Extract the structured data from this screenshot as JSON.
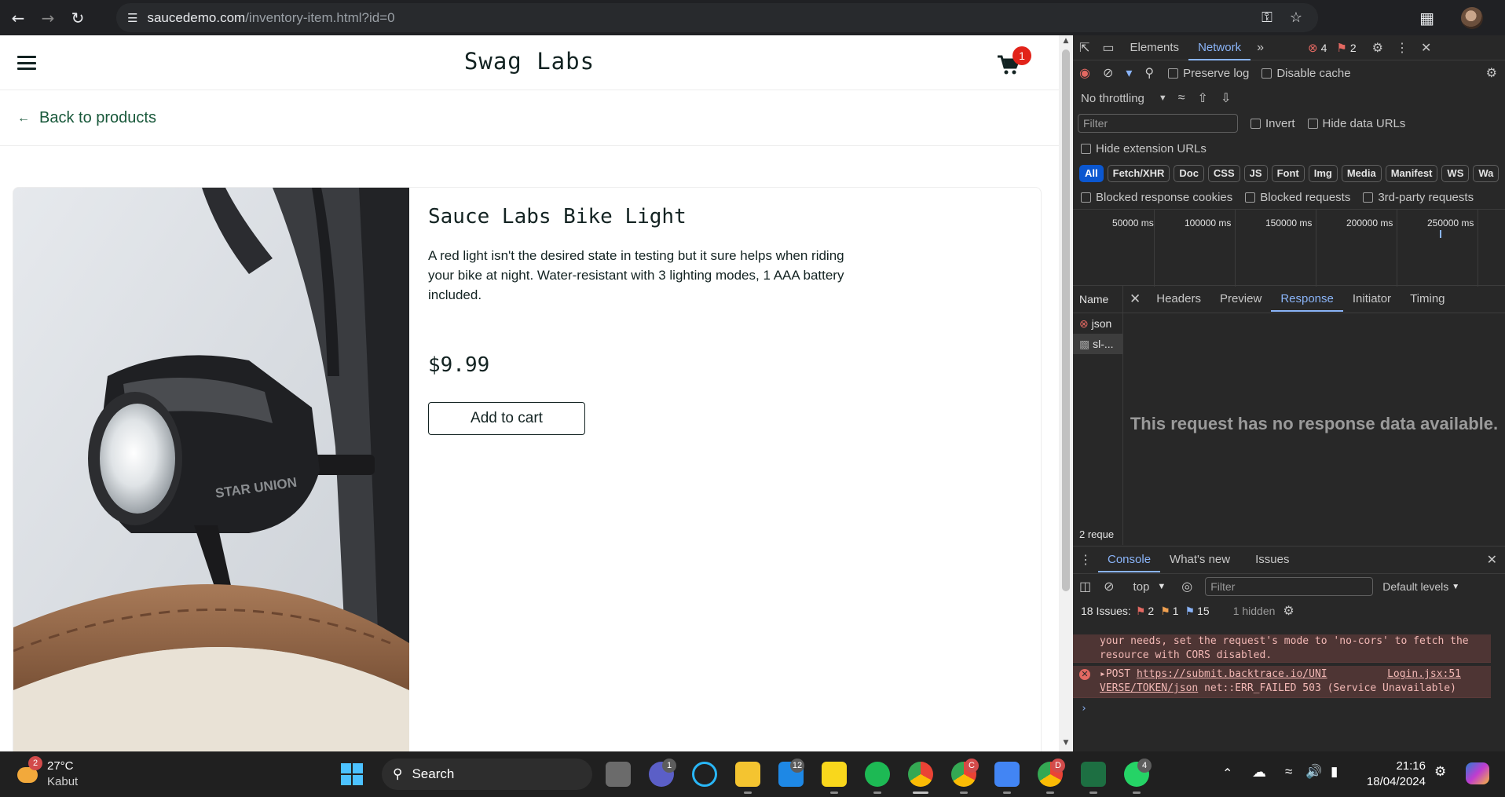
{
  "browser": {
    "url_host": "saucedemo.com",
    "url_path": "/inventory-item.html?id=0"
  },
  "app": {
    "logo": "Swag Labs",
    "cart_count": "1",
    "back_label": "Back to products"
  },
  "product": {
    "name": "Sauce Labs Bike Light",
    "description": "A red light isn't the desired state in testing but it sure helps when riding your bike at night. Water-resistant with 3 lighting modes, 1 AAA battery included.",
    "price": "$9.99",
    "add_to_cart": "Add to cart",
    "image_brand_text": "STAR UNION"
  },
  "devtools": {
    "tabs": [
      "Elements",
      "Network"
    ],
    "error_count": "4",
    "warning_count": "2",
    "preserve_log": "Preserve log",
    "disable_cache": "Disable cache",
    "throttling": "No throttling",
    "filter_placeholder": "Filter",
    "invert": "Invert",
    "hide_data_urls": "Hide data URLs",
    "hide_extension_urls": "Hide extension URLs",
    "type_filters": [
      "All",
      "Fetch/XHR",
      "Doc",
      "CSS",
      "JS",
      "Font",
      "Img",
      "Media",
      "Manifest",
      "WS",
      "Wa"
    ],
    "blocked_cookies": "Blocked response cookies",
    "blocked_requests": "Blocked requests",
    "third_party": "3rd-party requests",
    "timeline_ticks": [
      "50000 ms",
      "100000 ms",
      "150000 ms",
      "200000 ms",
      "250000 ms"
    ],
    "name_header": "Name",
    "requests": [
      "json",
      "sl-..."
    ],
    "request_count": "2 reque",
    "detail_tabs": [
      "Headers",
      "Preview",
      "Response",
      "Initiator",
      "Timing"
    ],
    "no_response": "This request has no response data available.",
    "drawer_tabs": [
      "Console",
      "What's new",
      "Issues"
    ],
    "context": "top",
    "console_filter": "Filter",
    "levels": "Default levels",
    "issues_label": "18 Issues:",
    "issues_err": "2",
    "issues_warn": "1",
    "issues_info": "15",
    "hidden": "1 hidden",
    "log_prev": "your needs, set the request's mode to 'no-cors' to fetch the resource with CORS disabled.",
    "log_method": "POST",
    "log_url_1": "https://submit.backtrace.io/UNI",
    "log_url_2": "VERSE/TOKEN/json",
    "log_source": "Login.jsx:51",
    "log_msg": "net::ERR_FAILED 503 (Service Unavailable)"
  },
  "taskbar": {
    "weather_badge": "2",
    "temp": "27°C",
    "condition": "Kabut",
    "search": "Search",
    "teams_badge": "1",
    "mail_badge": "12",
    "chrome2_badge": "C",
    "chrome3_badge": "D",
    "whatsapp_badge": "4",
    "time": "21:16",
    "date": "18/04/2024"
  }
}
